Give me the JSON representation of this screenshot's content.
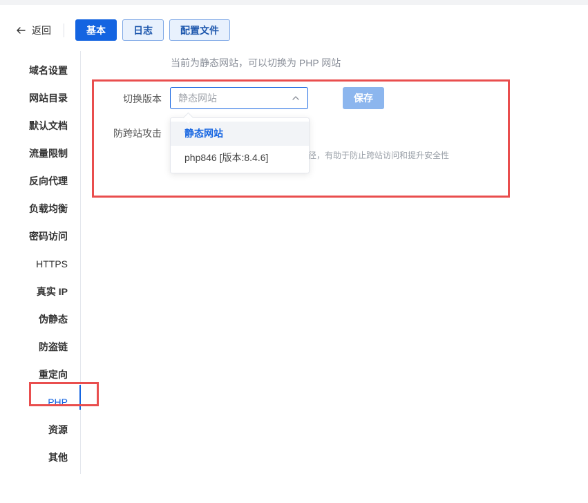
{
  "header": {
    "back_label": "返回",
    "tabs": [
      {
        "label": "基本",
        "active": true
      },
      {
        "label": "日志",
        "active": false
      },
      {
        "label": "配置文件",
        "active": false
      }
    ]
  },
  "sidebar": {
    "items": [
      {
        "label": "域名设置"
      },
      {
        "label": "网站目录"
      },
      {
        "label": "默认文档"
      },
      {
        "label": "流量限制"
      },
      {
        "label": "反向代理"
      },
      {
        "label": "负载均衡"
      },
      {
        "label": "密码访问"
      },
      {
        "label": "HTTPS"
      },
      {
        "label": "真实 IP"
      },
      {
        "label": "伪静态"
      },
      {
        "label": "防盗链"
      },
      {
        "label": "重定向"
      },
      {
        "label": "PHP",
        "active": true
      },
      {
        "label": "资源"
      },
      {
        "label": "其他"
      }
    ]
  },
  "main": {
    "notice": "当前为静态网站，可以切换为 PHP 网站",
    "version_label": "切换版本",
    "version_select_value": "静态网站",
    "save_label": "保存",
    "cross_site_label": "防跨站攻击",
    "cross_site_hint": "路径，有助于防止跨站访问和提升安全性",
    "dropdown_options": [
      {
        "label": "静态网站",
        "selected": true
      },
      {
        "label": "php846 [版本:8.4.6]",
        "selected": false
      }
    ]
  },
  "colors": {
    "accent": "#1464e1",
    "highlight": "#e94e4e",
    "save_disabled": "#8cb6ee"
  },
  "icons": {
    "back": "arrow-left-icon",
    "select": "chevron-up-icon"
  }
}
